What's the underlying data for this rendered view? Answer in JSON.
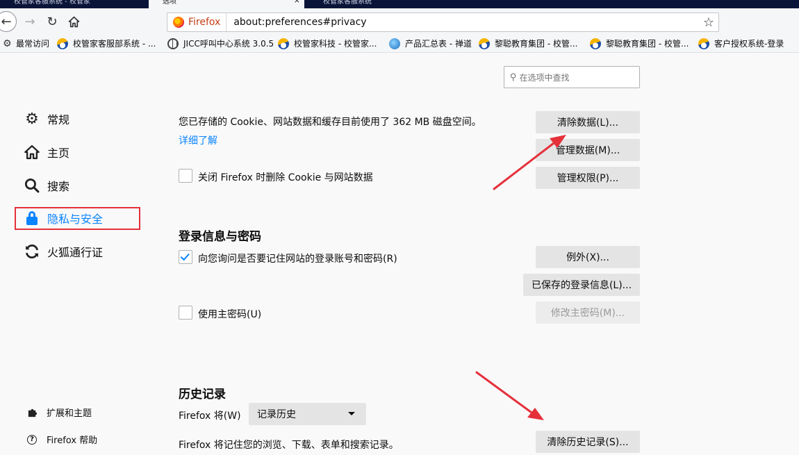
{
  "tabs": [
    {
      "label": "校管家客服系统 - 校管家",
      "active": false
    },
    {
      "label": "选项",
      "active": true
    },
    {
      "label": "校管家客服系统",
      "active": false
    }
  ],
  "navbar": {
    "identity_label": "Firefox",
    "url": "about:preferences#privacy"
  },
  "bookmarks": [
    {
      "label": "最常访问",
      "icon": "gear-icon"
    },
    {
      "label": "校管家客服部系统 - ...",
      "icon": "xgj-swirl-icon"
    },
    {
      "label": "JICC呼叫中心系统 3.0.5",
      "icon": "globe-icon"
    },
    {
      "label": "校管家科技 - 校管家...",
      "icon": "xgj-swirl-icon"
    },
    {
      "label": "产品汇总表 - 禅道",
      "icon": "chandao-icon"
    },
    {
      "label": "黎聪教育集团 - 校管...",
      "icon": "xgj-swirl-icon"
    },
    {
      "label": "黎聪教育集团 - 校管...",
      "icon": "xgj-swirl-icon"
    },
    {
      "label": "客户授权系统-登录",
      "icon": "xgj-swirl-icon"
    }
  ],
  "search": {
    "placeholder": "在选项中查找"
  },
  "sidebar": {
    "items": [
      {
        "label": "常规",
        "icon": "gear-icon"
      },
      {
        "label": "主页",
        "icon": "home-icon"
      },
      {
        "label": "搜索",
        "icon": "search-icon"
      },
      {
        "label": "隐私与安全",
        "icon": "lock-icon",
        "selected": true
      },
      {
        "label": "火狐通行证",
        "icon": "sync-icon"
      }
    ],
    "footer": [
      {
        "label": "扩展和主题",
        "icon": "puzzle-icon"
      },
      {
        "label": "Firefox 帮助",
        "icon": "help-icon"
      }
    ]
  },
  "cookies": {
    "usage_text": "您已存储的 Cookie、网站数据和缓存目前使用了 362 MB 磁盘空间。",
    "learn_more": "详细了解",
    "clear_button": "清除数据(L)...",
    "manage_button": "管理数据(M)...",
    "permissions_button": "管理权限(P)...",
    "delete_on_close_label": "关闭 Firefox 时删除 Cookie 与网站数据",
    "delete_on_close_checked": false
  },
  "logins": {
    "heading": "登录信息与密码",
    "ask_save_label": "向您询问是否要记住网站的登录账号和密码(R)",
    "ask_save_checked": true,
    "exceptions_button": "例外(X)...",
    "saved_logins_button": "已保存的登录信息(L)...",
    "master_password_label": "使用主密码(U)",
    "master_password_checked": false,
    "change_master_button": "修改主密码(M)..."
  },
  "history": {
    "heading": "历史记录",
    "will_label": "Firefox 将(W)",
    "mode_value": "记录历史",
    "description": "Firefox 将记住您的浏览、下载、表单和搜索记录。",
    "clear_history_button": "清除历史记录(S)..."
  },
  "colors": {
    "accent": "#0a84ff",
    "annotation_red": "#e5303a",
    "button_bg": "#e4e4e5"
  }
}
